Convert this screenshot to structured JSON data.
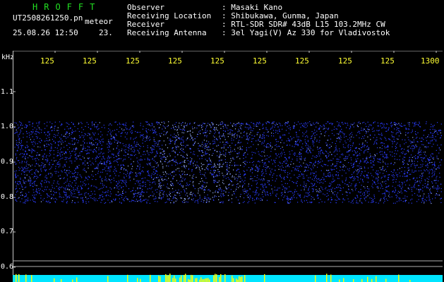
{
  "header": {
    "brand": "HROFFT",
    "file_name": "UT2508261250.pn",
    "meteor_label": "meteor",
    "date_time": "25.08.26 12:50",
    "count": "23."
  },
  "station_info": [
    {
      "label": "Observer",
      "value": ": Masaki Kano"
    },
    {
      "label": "Receiving Location",
      "value": ": Shibukawa, Gunma, Japan"
    },
    {
      "label": "Receiver",
      "value": ": RTL-SDR SDR# 43dB L15 103.2MHz CW"
    },
    {
      "label": "Receiving Antenna",
      "value": ": 3el Yagi(V) Az 330 for Vladivostok"
    }
  ],
  "time_ticks": [
    "125",
    "125",
    "125",
    "125",
    "125",
    "125",
    "125",
    "125",
    "125",
    "1300"
  ],
  "y_axis": {
    "unit": "kHz",
    "labels": [
      "1.1",
      "1.0",
      "0.9",
      "0.8",
      "0.7",
      "0.6"
    ]
  },
  "colors": {
    "background": "#000000",
    "text": "#ffffff",
    "tick_text": "#ffff33",
    "brand": "#22e022",
    "axis": "#c8c8c8",
    "noise": "#2a3cff",
    "noise_bright": "#9fb4ff",
    "signal_floor": "#00e5ff",
    "signal_spike": "#ffff00"
  }
}
